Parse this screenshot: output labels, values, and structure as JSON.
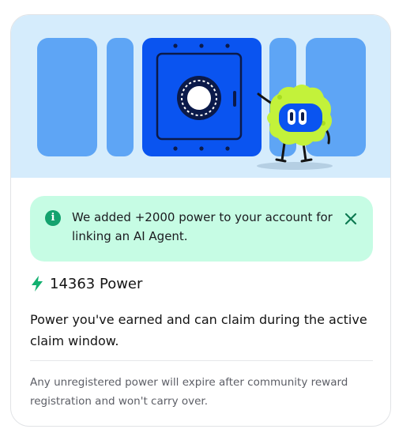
{
  "hero": {
    "illustration": "vault-with-mascot",
    "colors": {
      "background": "#d5ecfc",
      "panel": "#5ea5f5",
      "vault": "#0a54f0",
      "mascot": "#c3f23a"
    }
  },
  "notice": {
    "icon": "info-icon",
    "message": "We added +2000 power to your account for linking an AI Agent.",
    "close_icon": "close-icon",
    "background": "#c6fce4"
  },
  "power": {
    "icon": "lightning-bolt-icon",
    "label": "14363 Power",
    "accent": "#13b070"
  },
  "headline": "Power you've earned and can claim during the active claim window.",
  "footnote": "Any unregistered power will expire after community reward registration and won't carry over."
}
